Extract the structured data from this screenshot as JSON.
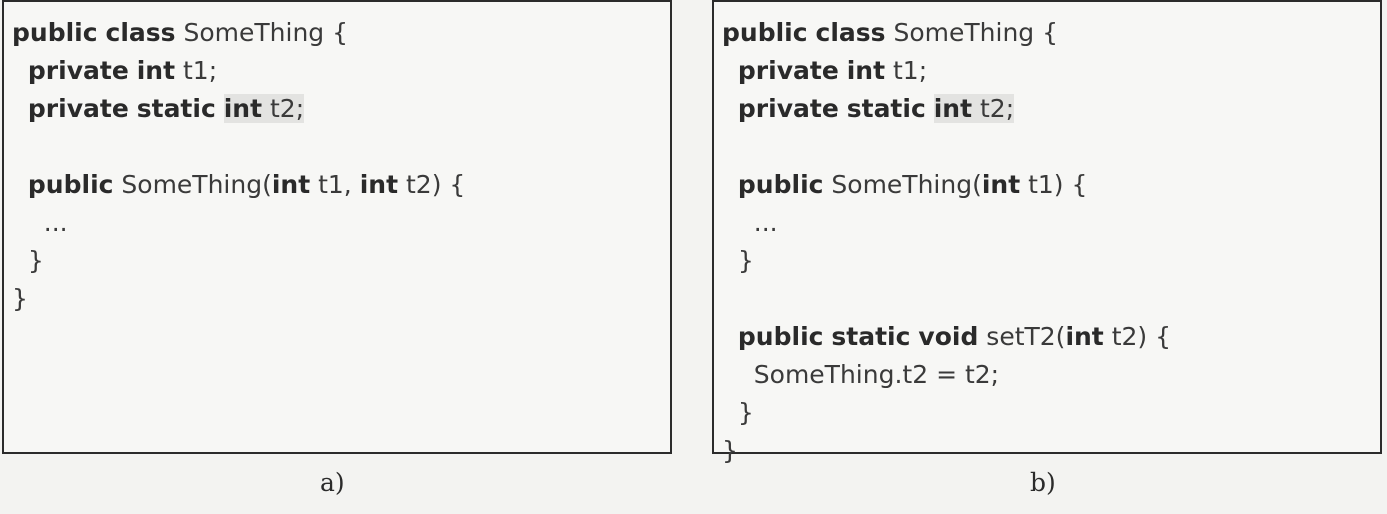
{
  "panels": [
    {
      "caption": "a)",
      "lines": [
        [
          {
            "t": "public",
            "s": "kw"
          },
          {
            "t": " "
          },
          {
            "t": "class",
            "s": "kw"
          },
          {
            "t": " SomeThing {"
          }
        ],
        [
          {
            "t": "  "
          },
          {
            "t": "private",
            "s": "kw"
          },
          {
            "t": " "
          },
          {
            "t": "int",
            "s": "kw"
          },
          {
            "t": " t1;"
          }
        ],
        [
          {
            "t": "  "
          },
          {
            "t": "private",
            "s": "kw"
          },
          {
            "t": " "
          },
          {
            "t": "static",
            "s": "kw"
          },
          {
            "t": " "
          },
          {
            "t": "int",
            "s": "kw hl"
          },
          {
            "t": " t2;",
            "s": "hl"
          }
        ],
        [],
        [
          {
            "t": "  "
          },
          {
            "t": "public",
            "s": "kw"
          },
          {
            "t": " SomeThing("
          },
          {
            "t": "int",
            "s": "kw"
          },
          {
            "t": " t1, "
          },
          {
            "t": "int",
            "s": "kw"
          },
          {
            "t": " t2) {"
          }
        ],
        [
          {
            "t": "    ..."
          }
        ],
        [
          {
            "t": "  }"
          }
        ],
        [
          {
            "t": "}"
          }
        ]
      ]
    },
    {
      "caption": "b)",
      "lines": [
        [
          {
            "t": "public",
            "s": "kw"
          },
          {
            "t": " "
          },
          {
            "t": "class",
            "s": "kw"
          },
          {
            "t": " SomeThing {"
          }
        ],
        [
          {
            "t": "  "
          },
          {
            "t": "private",
            "s": "kw"
          },
          {
            "t": " "
          },
          {
            "t": "int",
            "s": "kw"
          },
          {
            "t": " t1;"
          }
        ],
        [
          {
            "t": "  "
          },
          {
            "t": "private",
            "s": "kw"
          },
          {
            "t": " "
          },
          {
            "t": "static",
            "s": "kw"
          },
          {
            "t": " "
          },
          {
            "t": "int",
            "s": "kw hl"
          },
          {
            "t": " t2;",
            "s": "hl"
          }
        ],
        [],
        [
          {
            "t": "  "
          },
          {
            "t": "public",
            "s": "kw"
          },
          {
            "t": " SomeThing("
          },
          {
            "t": "int",
            "s": "kw"
          },
          {
            "t": " t1) {"
          }
        ],
        [
          {
            "t": "    ..."
          }
        ],
        [
          {
            "t": "  }"
          }
        ],
        [],
        [
          {
            "t": "  "
          },
          {
            "t": "public",
            "s": "kw"
          },
          {
            "t": " "
          },
          {
            "t": "static",
            "s": "kw"
          },
          {
            "t": " "
          },
          {
            "t": "void",
            "s": "kw"
          },
          {
            "t": " setT2("
          },
          {
            "t": "int",
            "s": "kw"
          },
          {
            "t": " t2) {"
          }
        ],
        [
          {
            "t": "    SomeThing.t2 = t2;"
          }
        ],
        [
          {
            "t": "  }"
          }
        ],
        [
          {
            "t": "}"
          }
        ]
      ]
    }
  ]
}
